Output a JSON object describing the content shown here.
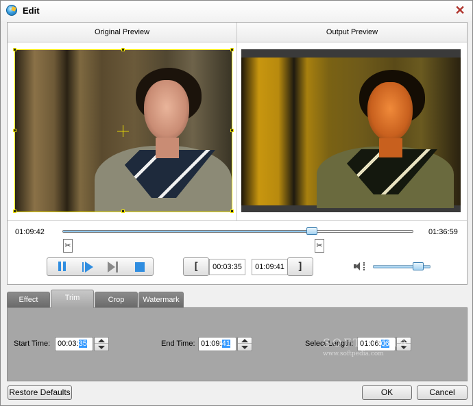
{
  "window": {
    "title": "Edit",
    "close_icon": "close-icon"
  },
  "preview": {
    "original_label": "Original Preview",
    "output_label": "Output Preview"
  },
  "timeline": {
    "current_time": "01:09:42",
    "total_time": "01:36:59",
    "position_fraction": 0.718
  },
  "trim_controls": {
    "set_start_label": "[",
    "start_time": "00:03:35",
    "end_time": "01:09:41",
    "set_end_label": "]"
  },
  "volume": {
    "level_fraction": 0.85
  },
  "tabs": [
    {
      "label": "Effect",
      "active": false
    },
    {
      "label": "Trim",
      "active": true
    },
    {
      "label": "Crop",
      "active": false
    },
    {
      "label": "Watermark",
      "active": false
    }
  ],
  "trim_panel": {
    "start_label": "Start Time:",
    "start_value_prefix": "00:03:",
    "start_value_selected": "35",
    "end_label": "End Time:",
    "end_value_prefix": "01:09:",
    "end_value_selected": "41",
    "length_label": "Select Length:",
    "length_value_prefix": "01:06:",
    "length_value_selected": "06"
  },
  "watermark": {
    "text": "SOFTPEDIA",
    "url": "www.softpedia.com"
  },
  "footer": {
    "restore_label": "Restore Defaults",
    "ok_label": "OK",
    "cancel_label": "Cancel"
  },
  "colors": {
    "accent_blue": "#2f8de0",
    "crop_frame": "#f4e800",
    "tab_panel": "#a6a6a6",
    "selection": "#3399ff",
    "close_red": "#b0342d"
  }
}
